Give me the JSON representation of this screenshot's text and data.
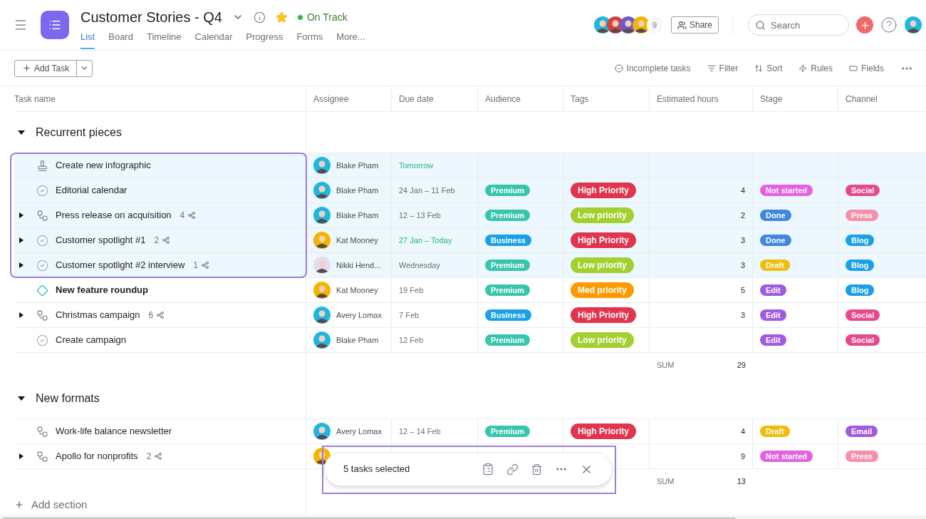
{
  "header": {
    "title": "Customer Stories - Q4",
    "starred": true,
    "status": "On Track",
    "tabs": [
      {
        "label": "List",
        "selected": true
      },
      {
        "label": "Board",
        "selected": false
      },
      {
        "label": "Timeline",
        "selected": false
      },
      {
        "label": "Calendar",
        "selected": false
      },
      {
        "label": "Progress",
        "selected": false
      },
      {
        "label": "Forms",
        "selected": false
      },
      {
        "label": "More...",
        "selected": false
      }
    ],
    "members": [
      {
        "color": "#1fb6e0"
      },
      {
        "color": "#d9413f"
      },
      {
        "color": "#6a5acd"
      },
      {
        "color": "#f5b400"
      }
    ],
    "member_count": "9",
    "share": "Share",
    "search_placeholder": "Search"
  },
  "toolbar": {
    "add_task": "Add Task",
    "actions": [
      {
        "kind": "incomplete",
        "label": "Incomplete tasks"
      },
      {
        "kind": "filter",
        "label": "Filter"
      },
      {
        "kind": "sort",
        "label": "Sort"
      },
      {
        "kind": "rules",
        "label": "Rules"
      },
      {
        "kind": "fields",
        "label": "Fields"
      }
    ]
  },
  "columns": [
    "Task name",
    "Assignee",
    "Due date",
    "Audience",
    "Tags",
    "Estimated hours",
    "Stage",
    "Channel"
  ],
  "sections": [
    {
      "name": "Recurrent pieces",
      "expanded": true,
      "sum_label": "SUM",
      "sum": "29",
      "tasks": [
        {
          "kind": "approval",
          "name": "Create new infographic",
          "selected": true,
          "assignee": {
            "name": "Blake Pham",
            "color": "#1fb6e0"
          },
          "due": {
            "text": "Tomorrow",
            "soon": true
          }
        },
        {
          "kind": "task",
          "name": "Editorial calendar",
          "selected": true,
          "assignee": {
            "name": "Blake Pham",
            "color": "#1fb6e0"
          },
          "due": {
            "text": "24 Jan – 11 Feb",
            "soon": false
          },
          "audience": {
            "label": "Premium",
            "color": "#37c5ab"
          },
          "tag": {
            "label": "High Priority",
            "color": "#e0344f"
          },
          "hours": "4",
          "stage": {
            "label": "Not started",
            "color": "#e362e3"
          },
          "channel": {
            "label": "Social",
            "color": "#e8488e"
          }
        },
        {
          "kind": "workflow",
          "name": "Press release on acquisition",
          "selected": true,
          "expanded": false,
          "subtasks": "4",
          "assignee": {
            "name": "Blake Pham",
            "color": "#1fb6e0"
          },
          "due": {
            "text": "12 – 13 Feb",
            "soon": false
          },
          "audience": {
            "label": "Premium",
            "color": "#37c5ab"
          },
          "tag": {
            "label": "Low priority",
            "color": "#a4cf30"
          },
          "hours": "2",
          "stage": {
            "label": "Done",
            "color": "#4186e0"
          },
          "channel": {
            "label": "Press",
            "color": "#f78fa9"
          }
        },
        {
          "kind": "task",
          "name": "Customer spotlight #1",
          "selected": true,
          "expanded": false,
          "subtasks": "2",
          "assignee": {
            "name": "Kat Mooney",
            "color": "#f5b400"
          },
          "due": {
            "text": "27 Jan – Today",
            "soon": true
          },
          "audience": {
            "label": "Business",
            "color": "#1aa0e6"
          },
          "tag": {
            "label": "High Priority",
            "color": "#e0344f"
          },
          "hours": "3",
          "stage": {
            "label": "Done",
            "color": "#4186e0"
          },
          "channel": {
            "label": "Blog",
            "color": "#1aa0e6"
          }
        },
        {
          "kind": "task",
          "name": "Customer spotlight #2 interview",
          "selected": true,
          "expanded": false,
          "subtasks": "1",
          "assignee": {
            "name": "Nikki Hend...",
            "color": "#e4dcef"
          },
          "due": {
            "text": "Wednesday",
            "soon": false
          },
          "audience": {
            "label": "Premium",
            "color": "#37c5ab"
          },
          "tag": {
            "label": "Low priority",
            "color": "#a4cf30"
          },
          "hours": "3",
          "stage": {
            "label": "Draft",
            "color": "#f1bd0c"
          },
          "channel": {
            "label": "Blog",
            "color": "#1aa0e6"
          }
        },
        {
          "kind": "milestone",
          "name": "New feature roundup",
          "selected": false,
          "assignee": {
            "name": "Kat Mooney",
            "color": "#f5b400"
          },
          "due": {
            "text": "19 Feb",
            "soon": false
          },
          "audience": {
            "label": "Premium",
            "color": "#37c5ab"
          },
          "tag": {
            "label": "Med priority",
            "color": "#fd9a00"
          },
          "hours": "5",
          "stage": {
            "label": "Edit",
            "color": "#a05be0"
          },
          "channel": {
            "label": "Blog",
            "color": "#1aa0e6"
          }
        },
        {
          "kind": "workflow",
          "name": "Christmas campaign",
          "selected": false,
          "expanded": false,
          "subtasks": "6",
          "assignee": {
            "name": "Avery Lomax",
            "color": "#1fb6e0"
          },
          "due": {
            "text": "7 Feb",
            "soon": false
          },
          "audience": {
            "label": "Business",
            "color": "#1aa0e6"
          },
          "tag": {
            "label": "High Priority",
            "color": "#e0344f"
          },
          "hours": "3",
          "stage": {
            "label": "Edit",
            "color": "#a05be0"
          },
          "channel": {
            "label": "Social",
            "color": "#e8488e"
          }
        },
        {
          "kind": "task",
          "name": "Create campaign",
          "selected": false,
          "assignee": {
            "name": "Blake Pham",
            "color": "#1fb6e0"
          },
          "due": {
            "text": "12 Feb",
            "soon": false
          },
          "audience": {
            "label": "Premium",
            "color": "#37c5ab"
          },
          "tag": {
            "label": "Low priority",
            "color": "#a4cf30"
          },
          "stage": {
            "label": "Edit",
            "color": "#a05be0"
          },
          "channel": {
            "label": "Social",
            "color": "#e8488e"
          }
        }
      ]
    },
    {
      "name": "New formats",
      "expanded": true,
      "sum_label": "SUM",
      "sum": "13",
      "tasks": [
        {
          "kind": "workflow",
          "name": "Work-life balance newsletter",
          "selected": false,
          "assignee": {
            "name": "Avery Lomax",
            "color": "#1fb6e0"
          },
          "due": {
            "text": "12 – 14 Feb",
            "soon": false
          },
          "audience": {
            "label": "Premium",
            "color": "#37c5ab"
          },
          "tag": {
            "label": "High Priority",
            "color": "#e0344f"
          },
          "hours": "4",
          "stage": {
            "label": "Draft",
            "color": "#f1bd0c"
          },
          "channel": {
            "label": "Email",
            "color": "#a05be0"
          }
        },
        {
          "kind": "workflow",
          "name": "Apollo for nonprofits",
          "selected": false,
          "expanded": false,
          "subtasks": "2",
          "assignee": {
            "color": "#f5b400"
          },
          "hours": "9",
          "stage": {
            "label": "Not started",
            "color": "#e362e3"
          },
          "channel": {
            "label": "Press",
            "color": "#f78fa9"
          }
        }
      ]
    }
  ],
  "add_section": "Add section",
  "selection_bar": {
    "text": "5 tasks selected"
  }
}
